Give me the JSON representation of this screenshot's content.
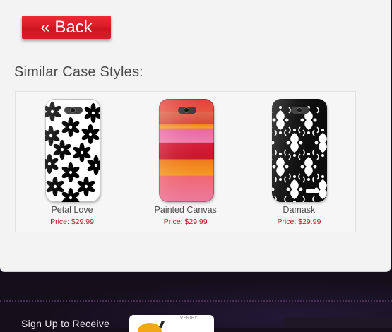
{
  "back_button": {
    "label": "« Back"
  },
  "similar": {
    "title": "Similar Case Styles:",
    "items": [
      {
        "name": "Petal Love",
        "price": "Price: $29.99",
        "pattern": "black-white-floral"
      },
      {
        "name": "Painted Canvas",
        "price": "Price: $29.99",
        "pattern": "painted-stripes"
      },
      {
        "name": "Damask",
        "price": "Price: $29.99",
        "pattern": "black-white-damask"
      }
    ]
  },
  "footer": {
    "signup_text": "Sign Up to Receive",
    "badge_text": "VERIFY"
  },
  "colors": {
    "accent_red": "#d71b25",
    "price_red": "#c8111f",
    "footer_bg": "#150f1c",
    "panel_bg": "#f3f3f3"
  }
}
